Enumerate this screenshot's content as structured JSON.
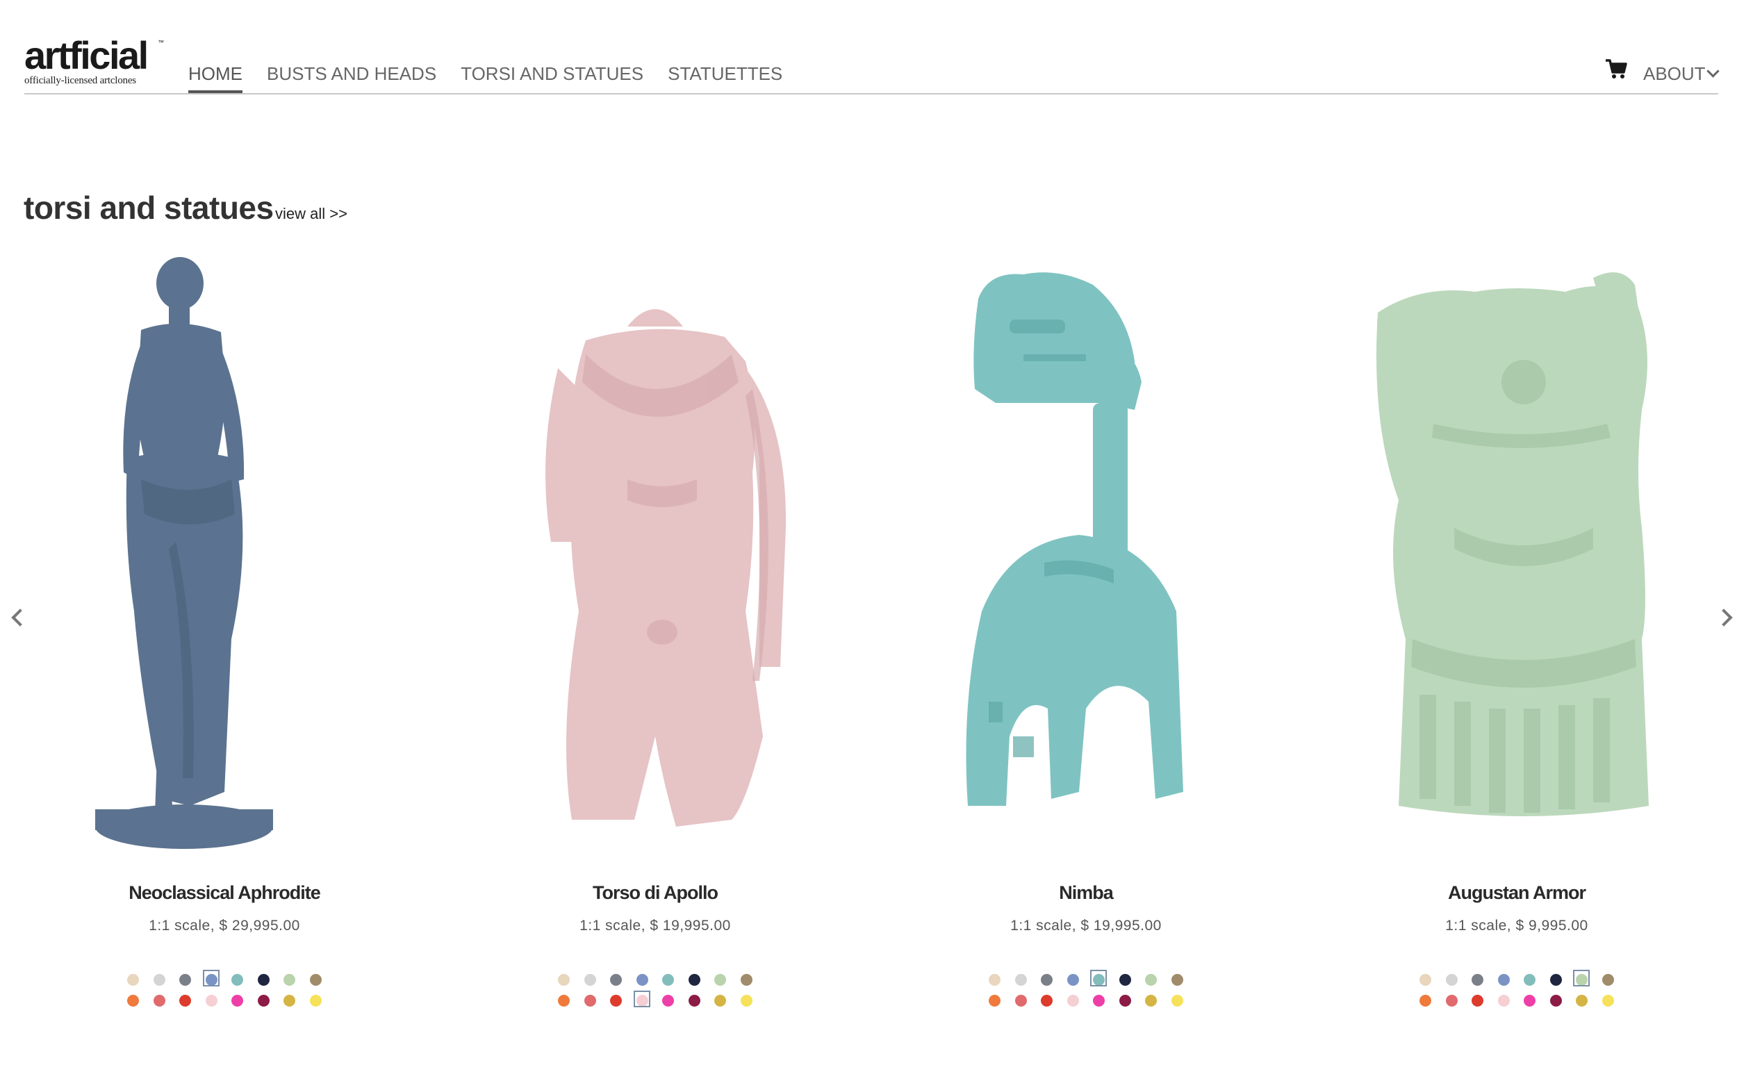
{
  "brand": {
    "name": "artficial",
    "trademark": "™",
    "tagline": "officially-licensed artclones"
  },
  "nav": {
    "items": [
      {
        "label": "HOME",
        "active": true
      },
      {
        "label": "BUSTS AND HEADS",
        "active": false
      },
      {
        "label": "TORSI AND STATUES",
        "active": false
      },
      {
        "label": "STATUETTES",
        "active": false
      }
    ],
    "cart_icon": "shopping-cart-icon",
    "about_label": "ABOUT"
  },
  "section": {
    "title": "torsi and statues",
    "view_all": "view all >>"
  },
  "palette": {
    "row1": [
      "#e8d6bd",
      "#d4d4d4",
      "#7b8088",
      "#7b93c4",
      "#83bdbb",
      "#1f2640",
      "#b9d3ac",
      "#a08c6a"
    ],
    "row2": [
      "#ef7a3c",
      "#e06a6c",
      "#dd3b2c",
      "#f5cfd3",
      "#ee3fa8",
      "#8c1b45",
      "#d4b544",
      "#f6e15a"
    ]
  },
  "products": [
    {
      "name": "Neoclassical Aphrodite",
      "price": "1:1 scale, $ 29,995.00",
      "color": "#5b7390",
      "selected_swatch": "row1-3"
    },
    {
      "name": "Torso di Apollo",
      "price": "1:1 scale, $ 19,995.00",
      "color": "#e6c3c5",
      "selected_swatch": "row2-3"
    },
    {
      "name": "Nimba",
      "price": "1:1 scale, $ 19,995.00",
      "color": "#7ec3c1",
      "selected_swatch": "row1-4"
    },
    {
      "name": "Augustan Armor",
      "price": "1:1 scale, $ 9,995.00",
      "color": "#bcd8bc",
      "selected_swatch": "row1-6"
    }
  ]
}
